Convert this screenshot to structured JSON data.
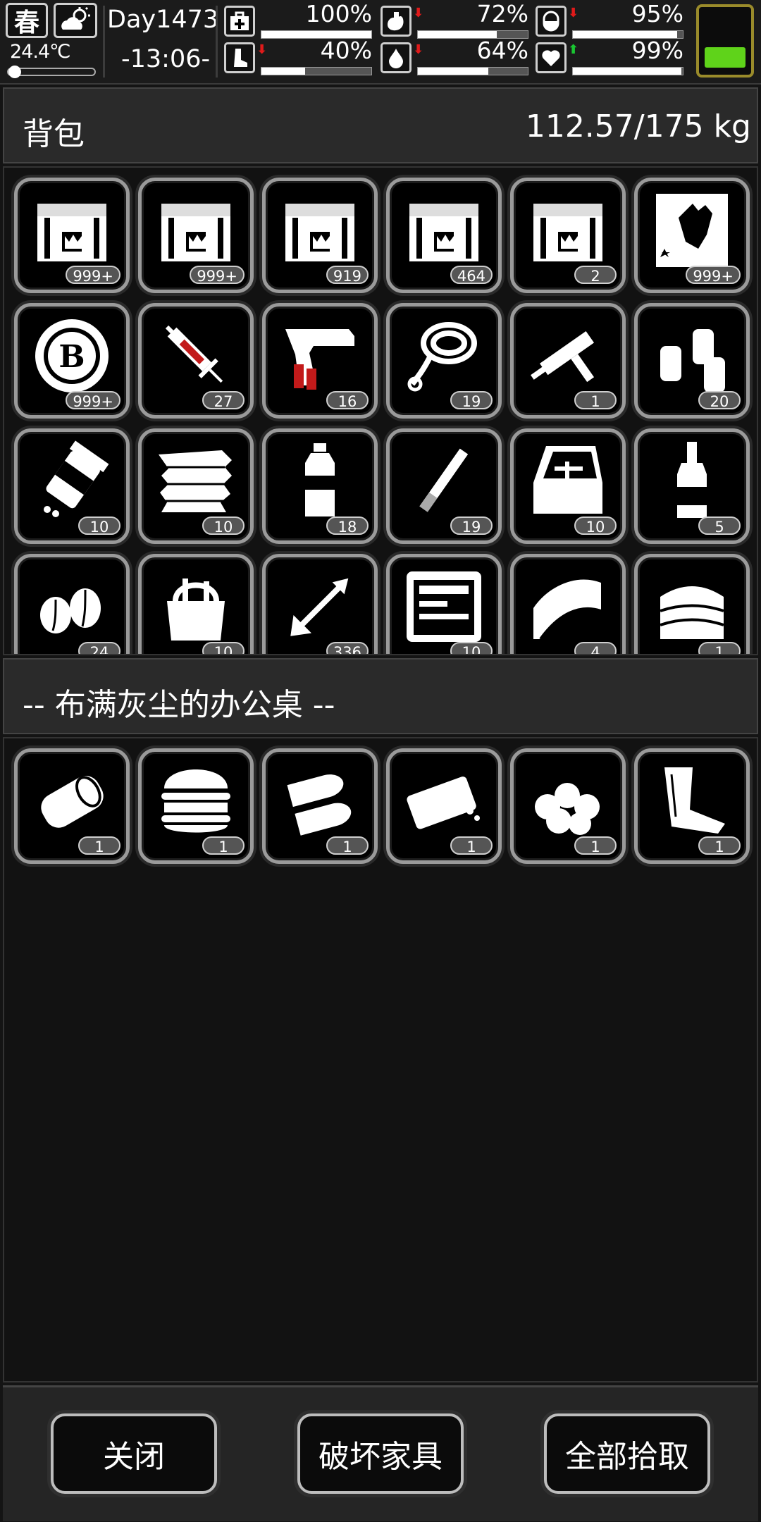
{
  "hud": {
    "season": "春",
    "temperature": "24.4℃",
    "day": "Day1473",
    "time": "-13:06-",
    "stats": [
      {
        "name": "health",
        "value": "100%",
        "level": 1.0,
        "trend": "none",
        "icon": "medkit-icon"
      },
      {
        "name": "hunger",
        "value": "72%",
        "level": 0.72,
        "trend": "down",
        "icon": "stomach-icon"
      },
      {
        "name": "mood",
        "value": "95%",
        "level": 0.95,
        "trend": "down",
        "icon": "pill-icon"
      },
      {
        "name": "stamina",
        "value": "40%",
        "level": 0.4,
        "trend": "down",
        "icon": "leg-icon"
      },
      {
        "name": "thirst",
        "value": "64%",
        "level": 0.64,
        "trend": "down",
        "icon": "water-drop-icon"
      },
      {
        "name": "spirit",
        "value": "99%",
        "level": 0.99,
        "trend": "up",
        "icon": "heart-icon"
      }
    ],
    "battery_level": 0.3,
    "colors": {
      "down": "#e01a1a",
      "up": "#19c531",
      "battery": "#5fd31a"
    }
  },
  "backpack": {
    "title": "背包",
    "weight": "112.57/175 kg",
    "items": [
      {
        "icon": "chest-i-icon",
        "count": "999+"
      },
      {
        "icon": "chest-ii-icon",
        "count": "999+"
      },
      {
        "icon": "chest-iii-icon",
        "count": "919"
      },
      {
        "icon": "chest-iv-icon",
        "count": "464"
      },
      {
        "icon": "chest-gold-icon",
        "count": "2"
      },
      {
        "icon": "zombie-card-icon",
        "count": "999+"
      },
      {
        "icon": "casino-chip-icon",
        "count": "999+"
      },
      {
        "icon": "syringe-icon",
        "count": "27"
      },
      {
        "icon": "flare-gun-icon",
        "count": "16"
      },
      {
        "icon": "rope-icon",
        "count": "19"
      },
      {
        "icon": "caulk-gun-icon",
        "count": "1"
      },
      {
        "icon": "bottles-icon",
        "count": "20"
      },
      {
        "icon": "pill-bottle-icon",
        "count": "10"
      },
      {
        "icon": "cloth-pile-icon",
        "count": "10"
      },
      {
        "icon": "water-bottle-icon",
        "count": "18"
      },
      {
        "icon": "cigarette-icon",
        "count": "19"
      },
      {
        "icon": "toolbox-open-icon",
        "count": "10"
      },
      {
        "icon": "liquor-bottle-icon",
        "count": "5"
      },
      {
        "icon": "seeds-icon",
        "count": "24"
      },
      {
        "icon": "tool-bag-icon",
        "count": "10"
      },
      {
        "icon": "arrow-icon",
        "count": "336"
      },
      {
        "icon": "toolkit-case-icon",
        "count": "10"
      },
      {
        "icon": "towel-icon",
        "count": "4"
      },
      {
        "icon": "folded-cloth-icon",
        "count": "1"
      }
    ]
  },
  "container": {
    "title": "-- 布满灰尘的办公桌 --",
    "items": [
      {
        "icon": "canned-fish-icon",
        "count": "1"
      },
      {
        "icon": "burger-icon",
        "count": "1"
      },
      {
        "icon": "bullets-icon",
        "count": "1"
      },
      {
        "icon": "bread-icon",
        "count": "1"
      },
      {
        "icon": "rocks-icon",
        "count": "1"
      },
      {
        "icon": "scrap-icon",
        "count": "1"
      }
    ]
  },
  "buttons": {
    "close": "关闭",
    "destroy": "破坏家具",
    "take_all": "全部拾取"
  }
}
